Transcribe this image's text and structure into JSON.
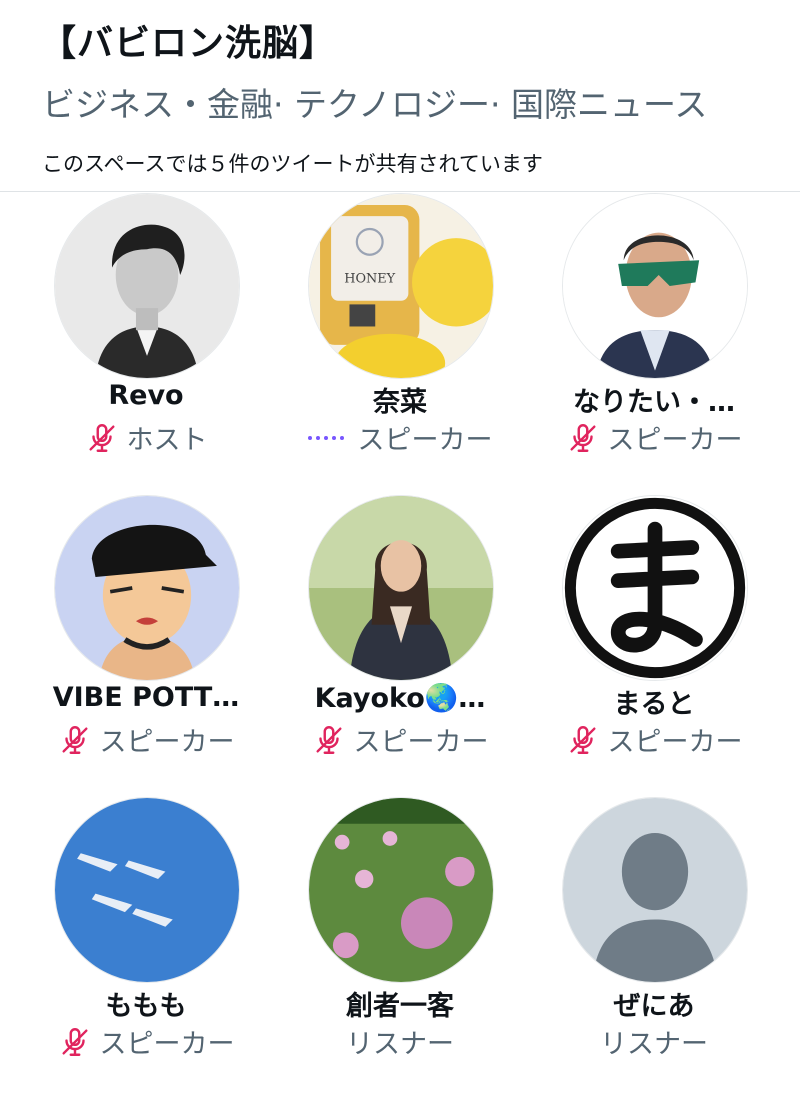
{
  "space": {
    "title": "【バビロン洗脳】",
    "topics": "ビジネス・金融· テクノロジー· 国際ニュース",
    "tweet_note": "このスペースでは５件のツイートが共有されています"
  },
  "participants": [
    {
      "name": "Revo",
      "role": "ホスト",
      "status_icon": "muted-mic-icon",
      "avatar": "man-portrait"
    },
    {
      "name": "奈菜",
      "role": "スピーカー",
      "status_icon": "speaking-dots-icon",
      "avatar": "honey-lemon"
    },
    {
      "name": "なりたい・…",
      "role": "スピーカー",
      "status_icon": "muted-mic-icon",
      "avatar": "masked-man"
    },
    {
      "name": "VIBE POTT…",
      "role": "スピーカー",
      "status_icon": "muted-mic-icon",
      "avatar": "cartoon-cap"
    },
    {
      "name": "Kayoko🌏…",
      "role": "スピーカー",
      "status_icon": "muted-mic-icon",
      "avatar": "woman-park"
    },
    {
      "name": "まると",
      "role": "スピーカー",
      "status_icon": "muted-mic-icon",
      "avatar": "ma-logo"
    },
    {
      "name": "ももも",
      "role": "スピーカー",
      "status_icon": "muted-mic-icon",
      "avatar": "jets-sky"
    },
    {
      "name": "創者一客",
      "role": "リスナー",
      "status_icon": "none",
      "avatar": "clover-flowers"
    },
    {
      "name": "ぜにあ",
      "role": "リスナー",
      "status_icon": "none",
      "avatar": "default-silhouette"
    }
  ],
  "colors": {
    "muted_icon": "#e0245e",
    "speaking_dots": "#7856ff",
    "secondary_text": "#536471"
  }
}
